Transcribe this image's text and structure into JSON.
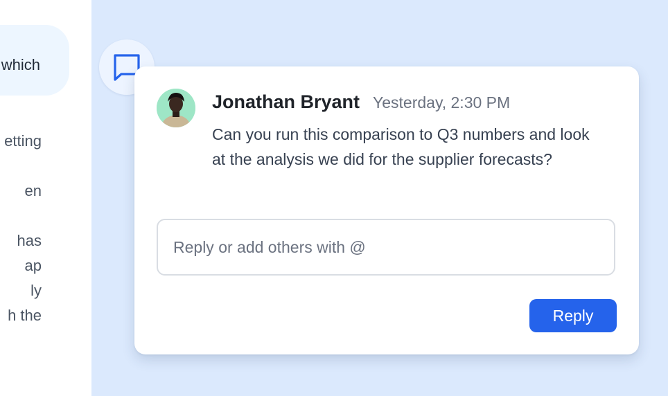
{
  "background_document": {
    "highlighted_fragment": "which",
    "lines": [
      "etting",
      "en",
      "has",
      "ap",
      "ly",
      "h the"
    ]
  },
  "comment": {
    "author": "Jonathan Bryant",
    "timestamp": "Yesterday, 2:30 PM",
    "message": "Can you run this comparison to Q3 numbers and look at the analysis we did for the supplier forecasts?",
    "reply_placeholder": "Reply or add others with @",
    "reply_button": "Reply"
  },
  "icons": {
    "comment_marker": "chat-bubble-icon"
  },
  "colors": {
    "canvas_background": "#dbe9fd",
    "accent": "#2563eb",
    "avatar_background": "#9ee6c6",
    "highlight": "#edf6ff"
  }
}
